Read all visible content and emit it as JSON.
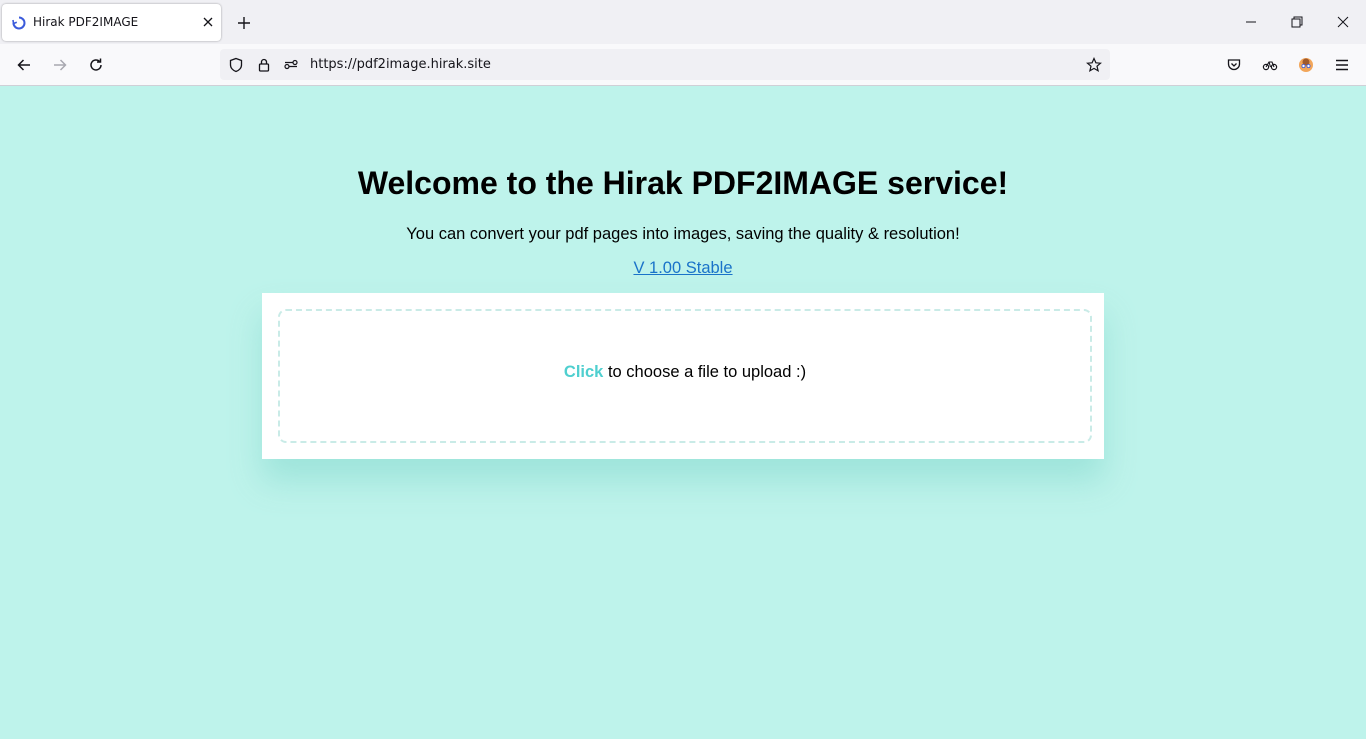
{
  "browser": {
    "tab": {
      "title": "Hirak PDF2IMAGE"
    },
    "url": "https://pdf2image.hirak.site"
  },
  "page": {
    "headline": "Welcome to the Hirak PDF2IMAGE service!",
    "subline": "You can convert your pdf pages into images, saving the quality & resolution!",
    "version_label": "V 1.00 Stable",
    "upload": {
      "click_label": "Click",
      "rest_label": " to choose a file to upload :)"
    }
  },
  "colors": {
    "page_background": "#bef3eb",
    "accent": "#4fcfcf",
    "link": "#1a73c9"
  }
}
